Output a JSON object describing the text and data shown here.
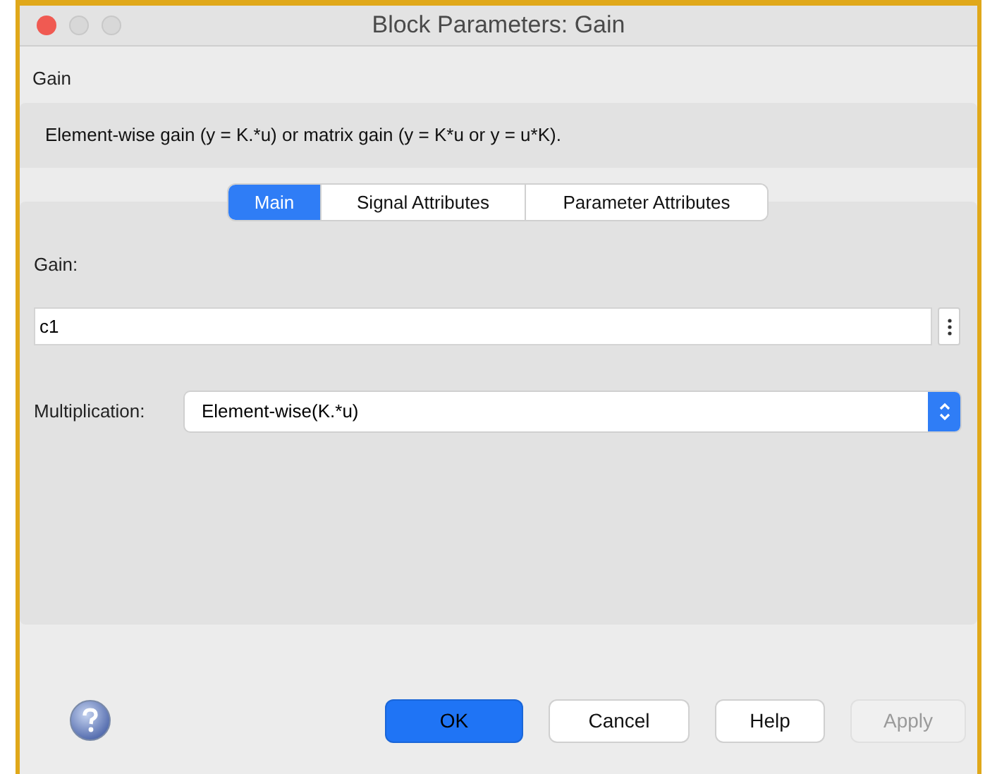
{
  "window": {
    "title": "Block Parameters: Gain"
  },
  "block_name": "Gain",
  "description": "Element-wise gain (y = K.*u) or matrix gain (y = K*u or y = u*K).",
  "tabs": [
    {
      "label": "Main",
      "selected": true
    },
    {
      "label": "Signal Attributes",
      "selected": false
    },
    {
      "label": "Parameter Attributes",
      "selected": false
    }
  ],
  "gain": {
    "label": "Gain:",
    "value": "c1"
  },
  "multiplication": {
    "label": "Multiplication:",
    "value": "Element-wise(K.*u)"
  },
  "buttons": [
    {
      "label": "OK",
      "default": true,
      "disabled": false
    },
    {
      "label": "Cancel",
      "default": false,
      "disabled": false
    },
    {
      "label": "Help",
      "default": false,
      "disabled": false
    },
    {
      "label": "Apply",
      "default": false,
      "disabled": true
    }
  ]
}
